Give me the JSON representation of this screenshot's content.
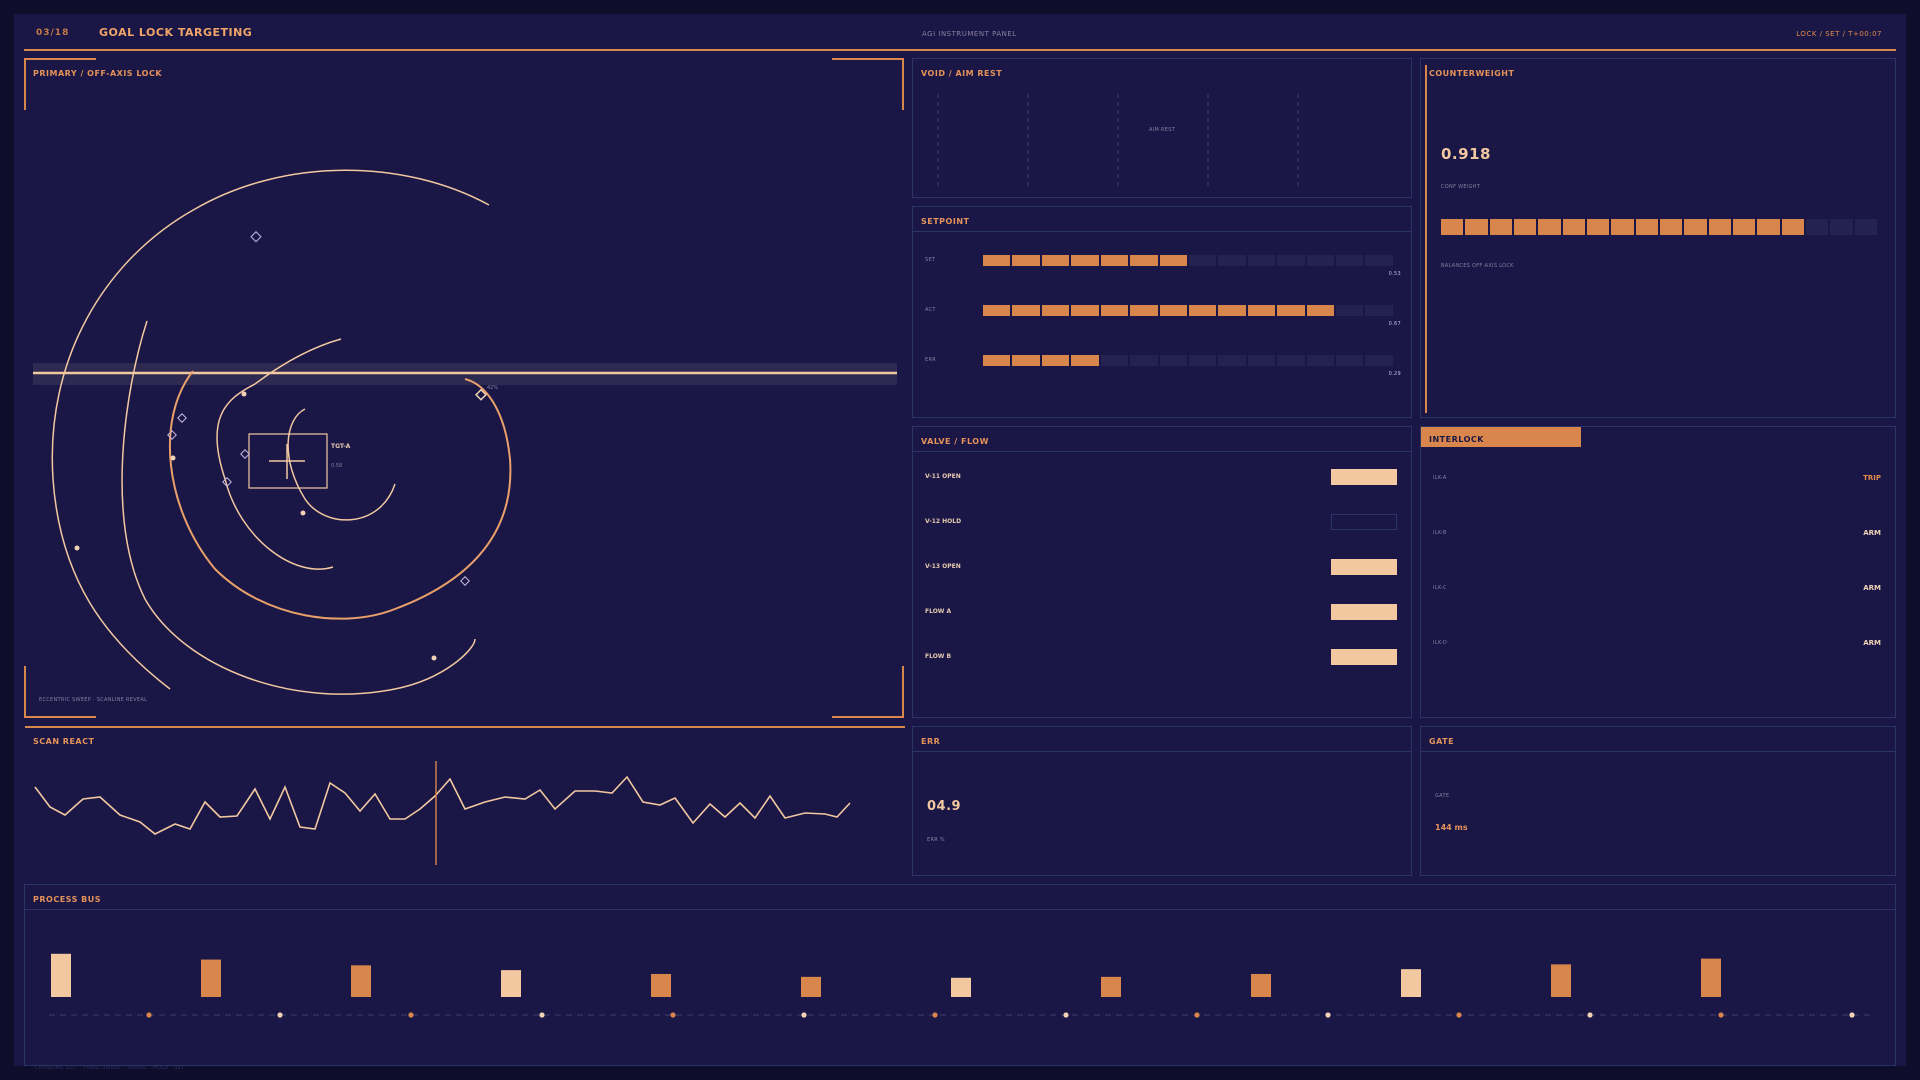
{
  "header": {
    "index": "03/18",
    "title": "GOAL LOCK TARGETING",
    "center": "AGI INSTRUMENT PANEL",
    "right": "LOCK / SET / T+00:07"
  },
  "primary": {
    "title": "PRIMARY  /  OFF-AXIS LOCK",
    "target_label": "TGT-A",
    "target_sub": "0.58",
    "marker_label": "42%",
    "footer": "ECCENTRIC SWEEP · SCANLINE REVEAL"
  },
  "void": {
    "title": "VOID  /  AIM REST",
    "center_label": "AIM REST"
  },
  "counterweight": {
    "title": "COUNTERWEIGHT",
    "value": "0.918",
    "sub": "CONF WEIGHT",
    "note": "BALANCES OFF-AXIS LOCK",
    "filled": 15,
    "total": 18
  },
  "setpoint": {
    "title": "SETPOINT",
    "rows": [
      {
        "label": "SET",
        "value": "0.53",
        "filled": 7,
        "total": 14
      },
      {
        "label": "ACT",
        "value": "0.67",
        "filled": 12,
        "total": 14
      },
      {
        "label": "ERR",
        "value": "0.29",
        "filled": 4,
        "total": 14
      }
    ]
  },
  "valve": {
    "title": "VALVE / FLOW",
    "rows": [
      {
        "label": "V-11  OPEN",
        "state": "on"
      },
      {
        "label": "V-12  HOLD",
        "state": "off"
      },
      {
        "label": "V-13  OPEN",
        "state": "on"
      },
      {
        "label": "FLOW A",
        "state": "on"
      },
      {
        "label": "FLOW B",
        "state": "on"
      }
    ]
  },
  "interlock": {
    "title": "INTERLOCK",
    "rows": [
      {
        "label": "ILK-A",
        "state": "TRIP"
      },
      {
        "label": "ILK-B",
        "state": "ARM"
      },
      {
        "label": "ILK-C",
        "state": "ARM"
      },
      {
        "label": "ILK-D",
        "state": "ARM"
      }
    ]
  },
  "scan": {
    "title": "SCAN REACT"
  },
  "err": {
    "title": "ERR",
    "value": "04.9",
    "sub": "ERR %"
  },
  "gate": {
    "title": "GATE",
    "sub": "GATE",
    "value": "144 ms"
  },
  "bus": {
    "title": "PROCESS BUS",
    "bars": [
      {
        "h": 0.9,
        "light": true
      },
      {
        "h": 0.78,
        "light": false
      },
      {
        "h": 0.66,
        "light": false
      },
      {
        "h": 0.56,
        "light": true
      },
      {
        "h": 0.48,
        "light": false
      },
      {
        "h": 0.42,
        "light": false
      },
      {
        "h": 0.4,
        "light": true
      },
      {
        "h": 0.42,
        "light": false
      },
      {
        "h": 0.48,
        "light": false
      },
      {
        "h": 0.58,
        "light": true
      },
      {
        "h": 0.68,
        "light": false
      },
      {
        "h": 0.8,
        "light": false
      }
    ],
    "footer": "CROSSING DOT · THIRD SWEEP · TRAVEL · HOLD · SET"
  },
  "colors": {
    "accent": "#d9864c",
    "light": "#f2c8a0",
    "panel": "#1a1746",
    "border": "#2b3466"
  }
}
